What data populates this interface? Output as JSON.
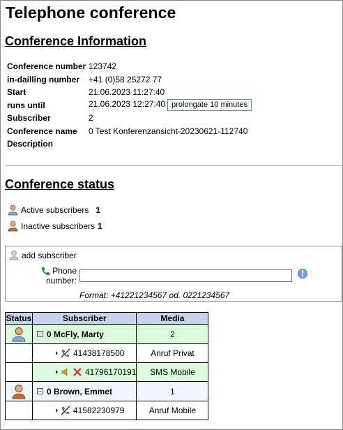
{
  "page": {
    "title": "Telephone conference"
  },
  "info": {
    "heading": "Conference Information",
    "rows": [
      {
        "label": "Conference number",
        "value": "123742"
      },
      {
        "label": "in-dailling number",
        "value": "+41 (0)58 25272 77"
      },
      {
        "label": "Start",
        "value": "21.06.2023 11:27:40"
      },
      {
        "label": "runs until",
        "value": "21.06.2023 12:27:40"
      },
      {
        "label": "Subscriber",
        "value": "2"
      },
      {
        "label": "Conference name",
        "value": "0 Test Konferenzansicht-20230621-112740"
      },
      {
        "label": "Description",
        "value": ""
      }
    ],
    "prolongate_label": "prolongate 10 minutes"
  },
  "status": {
    "heading": "Conference status",
    "active_label": "Active subscribers",
    "active_count": "1",
    "inactive_label": "Inactive subscribers",
    "inactive_count": "1"
  },
  "add": {
    "title": "add subscriber",
    "phone_label_1": "Phone",
    "phone_label_2": "number:",
    "phone_value": "",
    "format": "Format: +41221234567 od. 0221234567"
  },
  "table": {
    "headers": [
      "Status",
      "Subscriber",
      "Media"
    ],
    "groups": [
      {
        "name": "0 McFly, Marty",
        "media": "2",
        "active": true,
        "lines": [
          {
            "number": "41438178500",
            "media": "Anruf Privat",
            "icons": [
              "phone-off-icon"
            ]
          },
          {
            "number": "41796170191",
            "media": "SMS Mobile",
            "icons": [
              "audio-icon",
              "remove-icon"
            ]
          }
        ]
      },
      {
        "name": "0 Brown, Emmet",
        "media": "1",
        "active": false,
        "lines": [
          {
            "number": "41582230979",
            "media": "Anruf Mobile",
            "icons": [
              "phone-off-icon"
            ]
          }
        ]
      }
    ]
  },
  "colors": {
    "header_bg": "#c5d4ee",
    "active_group_bg": "#dbfadb",
    "inactive_group_bg": "#f1f6fe",
    "button_border": "#4b8fc2"
  }
}
